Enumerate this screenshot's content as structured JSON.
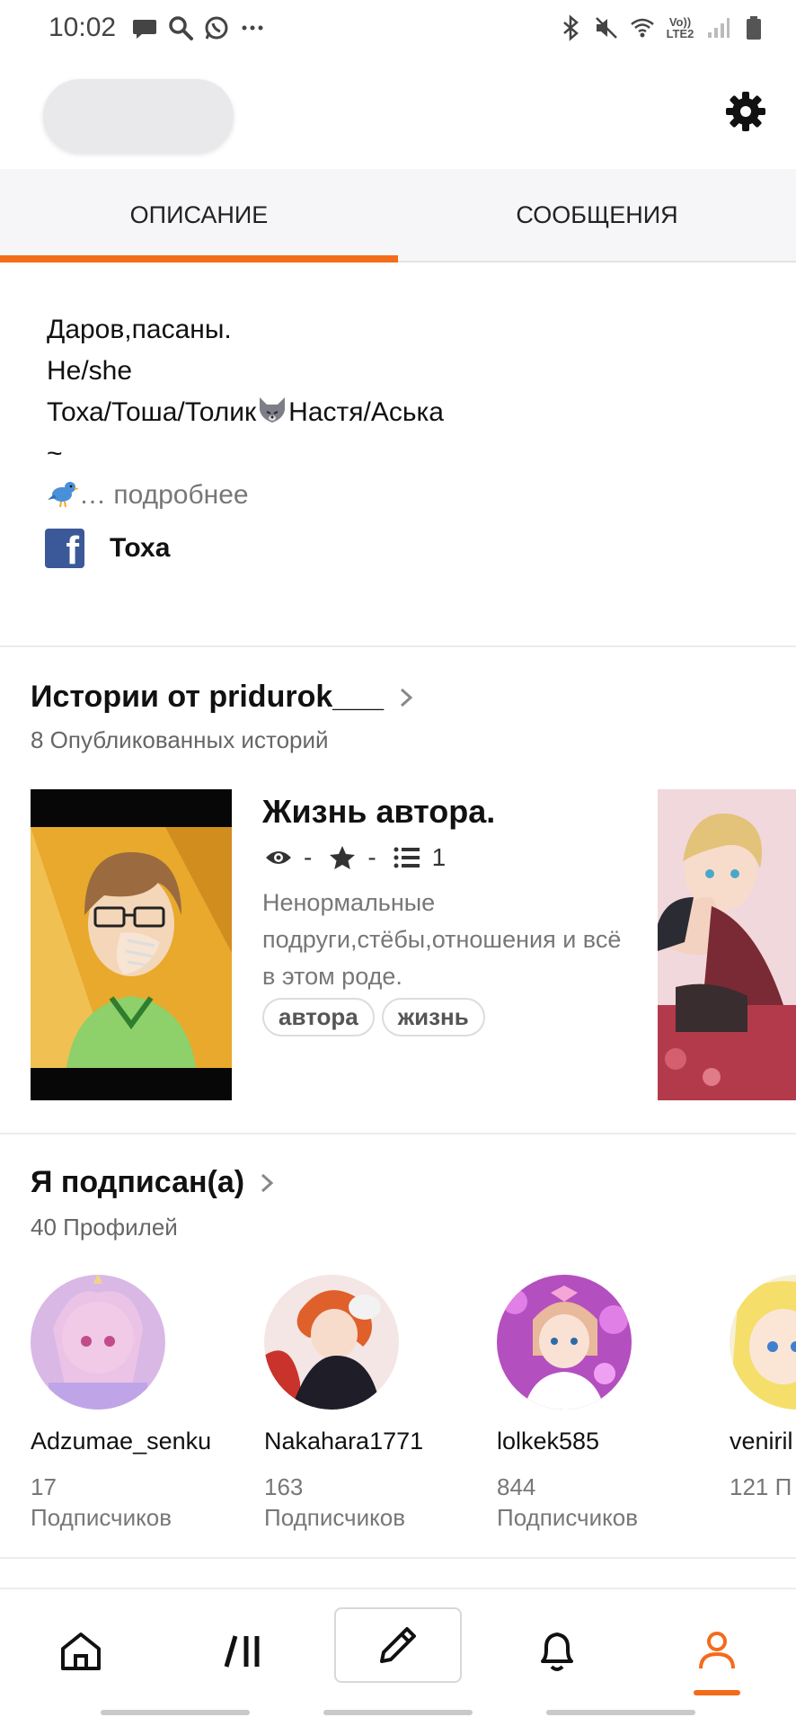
{
  "status_bar": {
    "time": "10:02",
    "network_label": "Vo)) LTE2",
    "left_icons": [
      "message-icon",
      "search-icon",
      "whatsapp-icon",
      "more-icon"
    ],
    "right_icons": [
      "bluetooth-icon",
      "mute-icon",
      "wifi-icon",
      "signal-icon",
      "battery-icon"
    ]
  },
  "tabs": [
    {
      "label": "ОПИСАНИЕ",
      "active": true
    },
    {
      "label": "СООБЩЕНИЯ",
      "active": false
    }
  ],
  "description": {
    "line1": "Даров,пасаны.",
    "line2": "He/she",
    "line3_a": "Тоха/Тоша/Толик",
    "line3_b": "Настя/Аська",
    "line4": "~",
    "more": "… подробнее"
  },
  "social": {
    "network": "facebook",
    "name": "Тоха"
  },
  "stories": {
    "title": "Истории от pridurok___",
    "subtitle": "8 Опубликованных историй",
    "items": [
      {
        "title": "Жизнь автора.",
        "views": "-",
        "rating": "-",
        "chapters": "1",
        "description": "Ненормальные подруги,стёбы,отношения и всё в этом роде.",
        "tags": [
          "автора",
          "жизнь"
        ]
      }
    ]
  },
  "following": {
    "title": "Я подписан(а)",
    "subtitle": "40 Профилей",
    "profiles": [
      {
        "name": "Adzumae_senku",
        "count": "17",
        "label": "Подписчиков"
      },
      {
        "name": "Nakahara1771",
        "count": "163",
        "label": "Подписчиков"
      },
      {
        "name": "lolkek585",
        "count": "844",
        "label": "Подписчиков"
      },
      {
        "name": "veniril",
        "count": "121 П",
        "label": ""
      }
    ]
  },
  "bottom_nav": [
    "home-icon",
    "library-icon",
    "write-icon",
    "notifications-icon",
    "profile-icon"
  ],
  "colors": {
    "accent": "#f46b1a",
    "facebook": "#3b5998"
  }
}
